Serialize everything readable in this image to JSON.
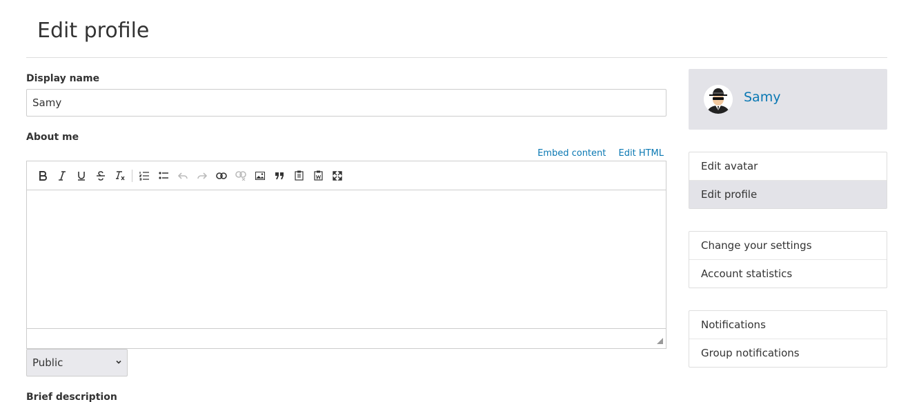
{
  "page": {
    "title": "Edit profile"
  },
  "form": {
    "display_name_label": "Display name",
    "display_name_value": "Samy",
    "about_label": "About me",
    "embed_link": "Embed content",
    "edit_html_link": "Edit HTML",
    "toolbar_icons": [
      "bold-icon",
      "italic-icon",
      "underline-icon",
      "strikethrough-icon",
      "remove-format-icon",
      "numbered-list-icon",
      "bulleted-list-icon",
      "undo-icon",
      "redo-icon",
      "link-icon",
      "unlink-icon",
      "image-icon",
      "blockquote-icon",
      "paste-text-icon",
      "paste-word-icon",
      "maximize-icon"
    ],
    "access_value": "Public",
    "brief_label": "Brief description"
  },
  "profile": {
    "name": "Samy"
  },
  "menus": {
    "group1": [
      "Edit avatar",
      "Edit profile"
    ],
    "group2": [
      "Change your settings",
      "Account statistics"
    ],
    "group3": [
      "Notifications",
      "Group notifications"
    ]
  },
  "colors": {
    "link": "#0a78b3",
    "active_bg": "#e3e3e8"
  }
}
